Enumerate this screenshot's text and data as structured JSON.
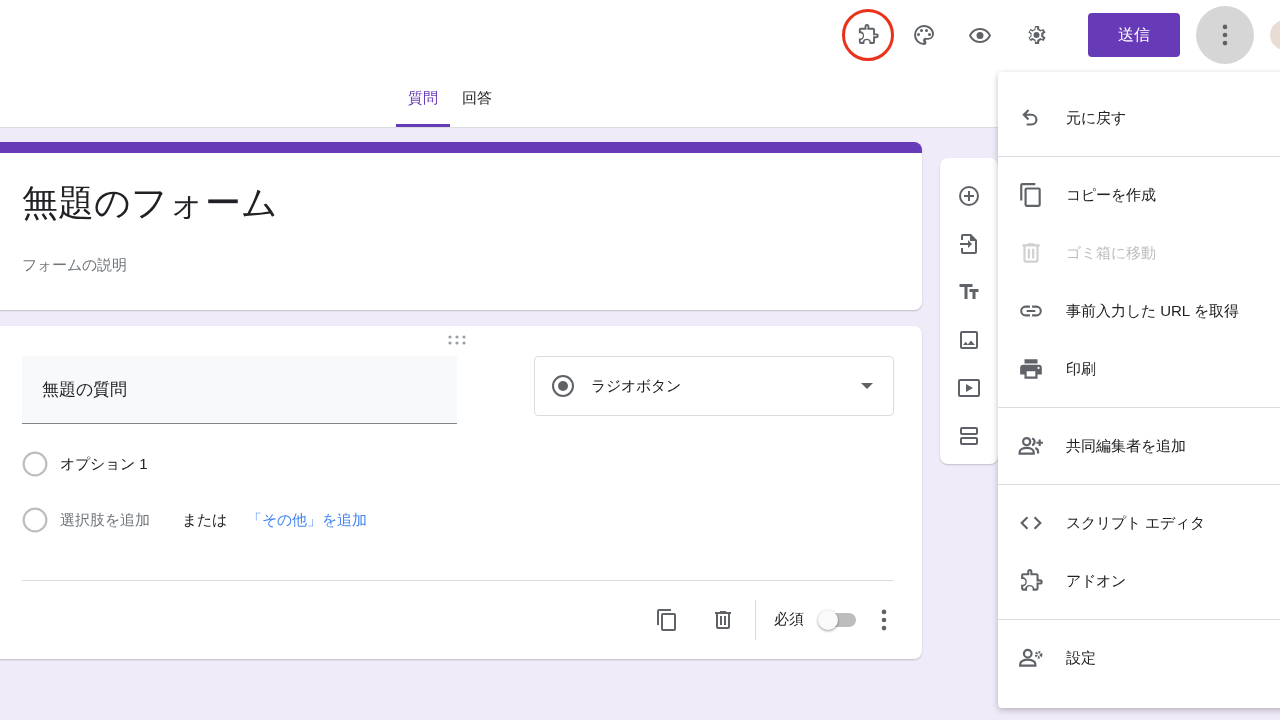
{
  "toolbar_buttons": [
    {
      "highlighted": true
    },
    {
      "highlighted": false
    },
    {
      "highlighted": false
    },
    {
      "highlighted": false
    }
  ],
  "send_button": "送信",
  "more_button": {
    "pressed": true
  },
  "tabs": [
    {
      "label": "質問",
      "selected": true
    },
    {
      "label": "回答",
      "selected": false
    }
  ],
  "form": {
    "title": "無題のフォーム",
    "description": {
      "placeholder": "フォームの説明"
    }
  },
  "question": {
    "title": "無題の質問",
    "type": "ラジオボタン",
    "options": [
      {
        "label": "オプション 1",
        "selected": false
      }
    ],
    "add_option": {
      "placeholder": "選択肢を追加",
      "selected": false
    },
    "or_text": "または",
    "add_other_link": "「その他」を追加",
    "required_label": "必須",
    "required": false
  },
  "menu": {
    "groups": [
      [
        {
          "label": "元に戻す",
          "disabled": false
        }
      ],
      [
        {
          "label": "コピーを作成",
          "disabled": false
        },
        {
          "label": "ゴミ箱に移動",
          "disabled": true
        },
        {
          "label": "事前入力した URL を取得",
          "disabled": false
        },
        {
          "label": "印刷",
          "disabled": false
        }
      ],
      [
        {
          "label": "共同編集者を追加",
          "disabled": false
        }
      ],
      [
        {
          "label": "スクリプト エディタ",
          "disabled": false
        },
        {
          "label": "アドオン",
          "disabled": false
        }
      ],
      [
        {
          "label": "設定",
          "disabled": false
        }
      ]
    ]
  }
}
